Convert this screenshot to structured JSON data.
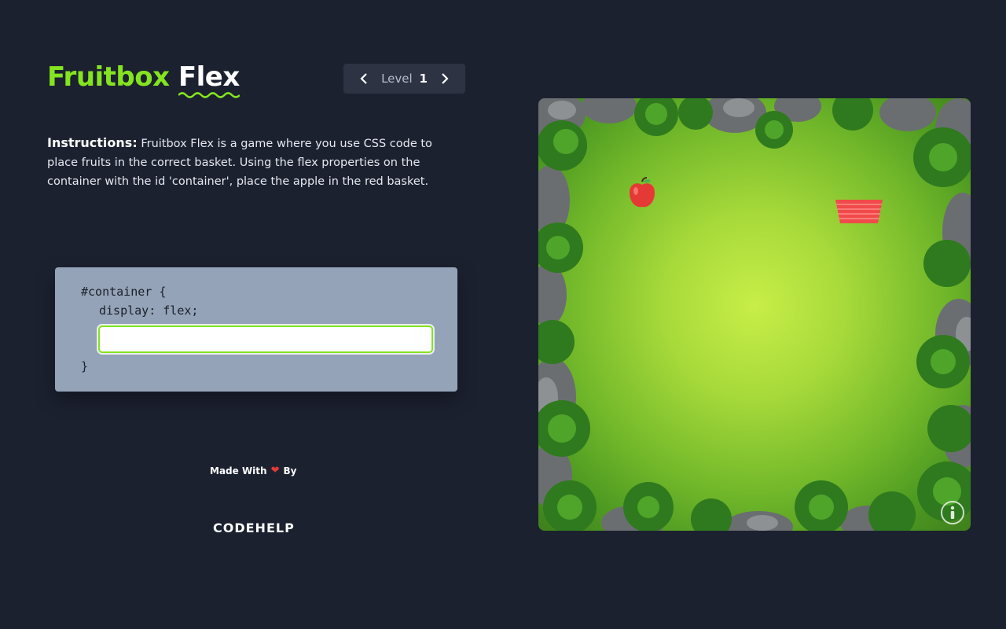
{
  "header": {
    "title_part1": "Fruitbox",
    "title_part2": "Flex",
    "accent_color": "#84e41f"
  },
  "level_nav": {
    "label": "Level",
    "number": "1",
    "prev_icon": "chevron-left-icon",
    "next_icon": "chevron-right-icon"
  },
  "instructions": {
    "heading": "Instructions:",
    "text": "Fruitbox Flex is a game where you use CSS code to place fruits in the correct basket. Using the flex properties on the container with the id 'container', place the apple in the red basket."
  },
  "editor": {
    "line1": "#container {",
    "line2": "display: flex;",
    "input_value": "",
    "line_end": "}"
  },
  "footer": {
    "made_with": "Made With",
    "by": "By",
    "heart_icon": "heart-icon",
    "brand": "CODEHELP"
  },
  "board": {
    "fruit": "apple",
    "basket_color": "#f04a4a",
    "info_icon": "info-icon"
  }
}
